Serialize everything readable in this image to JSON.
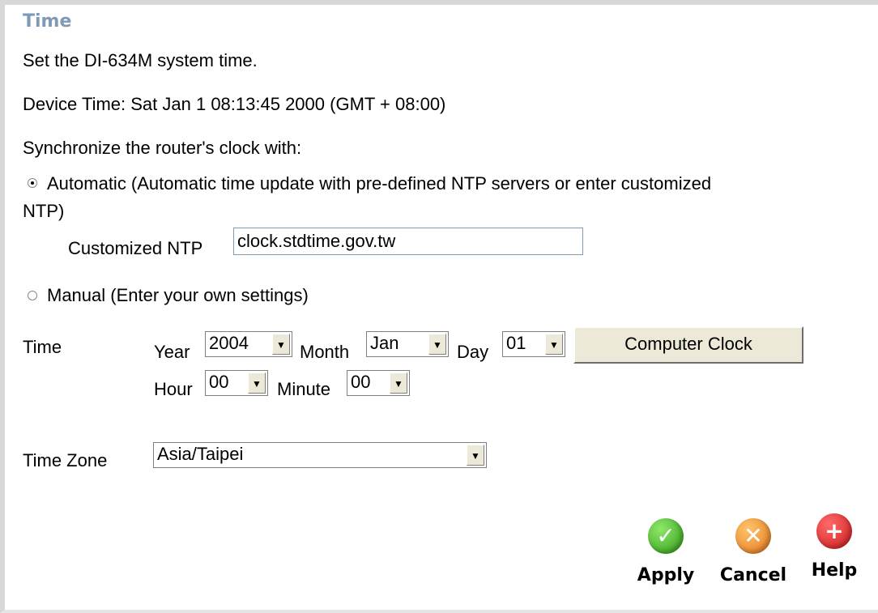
{
  "section_title": "Time",
  "intro": "Set the DI-634M system time.",
  "device_time": "Device Time:  Sat Jan 1 08:13:45 2000 (GMT + 08:00)",
  "sync_label": "Synchronize the router's clock with:",
  "automatic": {
    "label_line1": "Automatic (Automatic time update with pre-defined NTP servers or enter customized",
    "label_line2": "NTP)",
    "selected": true
  },
  "ntp": {
    "label": "Customized NTP",
    "value": "clock.stdtime.gov.tw"
  },
  "manual": {
    "label": "Manual (Enter your own settings)",
    "selected": false
  },
  "time_section": {
    "label": "Time",
    "year_label": "Year",
    "year_value": "2004",
    "month_label": "Month",
    "month_value": "Jan",
    "day_label": "Day",
    "day_value": "01",
    "hour_label": "Hour",
    "hour_value": "00",
    "minute_label": "Minute",
    "minute_value": "00",
    "computer_clock_button": "Computer Clock"
  },
  "timezone": {
    "label": "Time Zone",
    "value": "Asia/Taipei"
  },
  "actions": {
    "apply": "Apply",
    "cancel": "Cancel",
    "help": "Help",
    "apply_color": "#2e9a15",
    "cancel_color": "#e2751c",
    "help_color": "#cc1a1a"
  }
}
